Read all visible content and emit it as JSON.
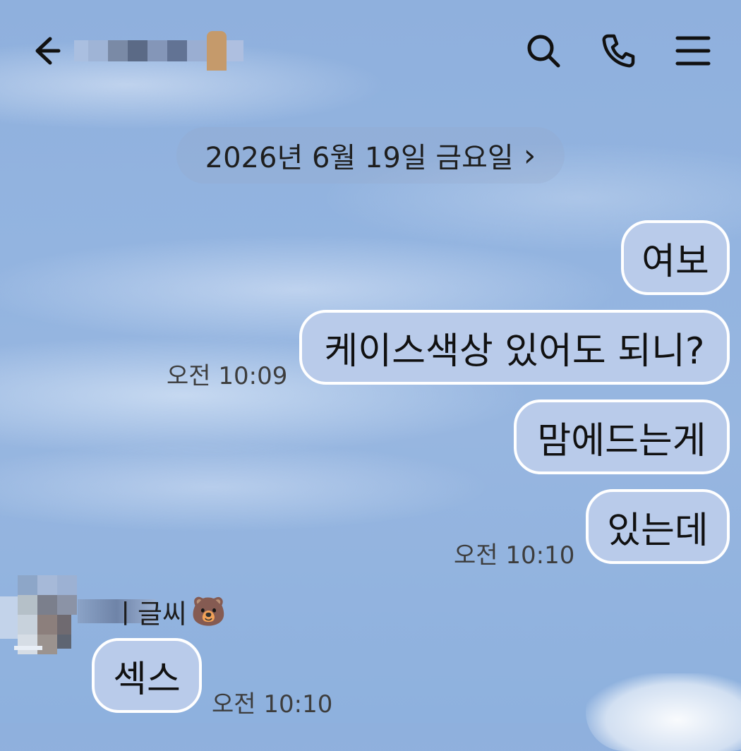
{
  "header": {
    "back_icon": "arrow-left-icon",
    "contact_name_icon": "bear-emoji-icon",
    "actions": [
      {
        "name": "search",
        "icon": "search-icon"
      },
      {
        "name": "call",
        "icon": "phone-icon"
      },
      {
        "name": "menu",
        "icon": "menu-icon"
      }
    ]
  },
  "date_separator": {
    "label": "2026년 6월 19일 금요일",
    "chevron": "›"
  },
  "messages": [
    {
      "side": "sent",
      "text": "여보"
    },
    {
      "side": "sent",
      "text": "케이스색상 있어도 되니?",
      "time": "오전 10:09"
    },
    {
      "side": "sent",
      "text": "맘에드는게"
    },
    {
      "side": "sent",
      "text": "있는데",
      "time": "오전 10:10"
    },
    {
      "side": "received",
      "text": "섹스",
      "time": "오전 10:10"
    }
  ],
  "received_sender": {
    "name_suffix": "ㅣ글씨",
    "emoji": "🐻"
  },
  "colors": {
    "bubble_fill": "#b9cbea",
    "bubble_border": "#ffffff",
    "background": "#93b4e0"
  }
}
